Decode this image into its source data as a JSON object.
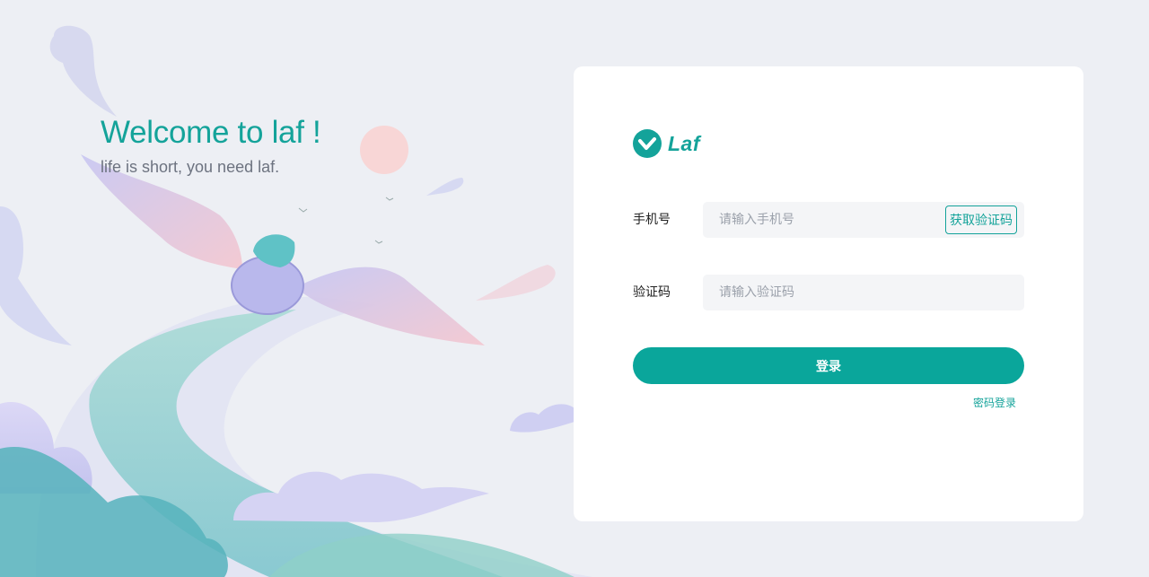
{
  "welcome": {
    "title": "Welcome to laf !",
    "subtitle": "life is short, you need laf."
  },
  "logo": {
    "icon": "laf-logo-icon",
    "text": "Laf"
  },
  "login_form": {
    "phone_label": "手机号",
    "phone_placeholder": "请输入手机号",
    "get_code_label": "获取验证码",
    "code_label": "验证码",
    "code_placeholder": "请输入验证码",
    "login_label": "登录",
    "password_login_link": "密码登录"
  },
  "colors": {
    "brand": "#14a39a",
    "button": "#0aa69b",
    "background": "#edeff4"
  }
}
